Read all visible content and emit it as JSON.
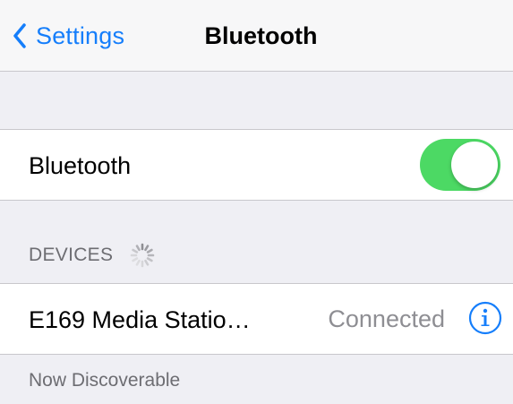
{
  "nav": {
    "back_label": "Settings",
    "title": "Bluetooth"
  },
  "bluetooth_row": {
    "label": "Bluetooth",
    "toggle_state": "on"
  },
  "devices_section": {
    "header": "DEVICES",
    "loading": true
  },
  "devices": [
    {
      "name": "E169 Media Statio…",
      "status": "Connected",
      "info_icon": "info-circle-icon"
    }
  ],
  "footer": {
    "text": "Now Discoverable"
  },
  "colors": {
    "accent": "#157efb",
    "toggle_on": "#4cd964",
    "background": "#efeff4",
    "secondary_text": "#6d6d72",
    "status_text": "#8e8e93"
  }
}
